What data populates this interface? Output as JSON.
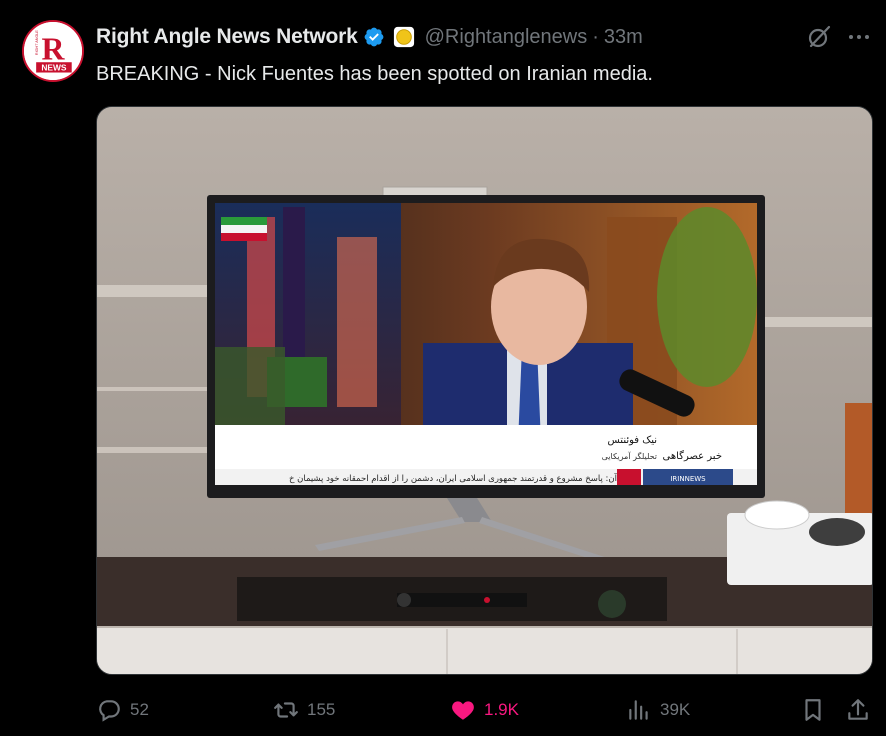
{
  "tweet": {
    "display_name": "Right Angle News Network",
    "handle": "@Rightanglenews",
    "separator": "·",
    "time": "33m",
    "text": "BREAKING - Nick Fuentes has been spotted on Iranian media.",
    "avatar": {
      "letter": "R",
      "brand_top": "RIGHT ANGLE",
      "brand_bottom": "NEWS"
    }
  },
  "media": {
    "tv_caption_name": "نیک فوئنتس",
    "tv_caption_title": "تحلیلگر آمریکایی",
    "tv_caption_channel": "خبر عصرگاهی",
    "tv_ticker": "آن: پاسخ مشروع و قدرتمند جمهوری اسلامی ایران، دشمن را از اقدام احمقانه خود پشیمان خ",
    "tv_logo": "IRINNEWS"
  },
  "actions": {
    "reply_count": "52",
    "repost_count": "155",
    "like_count": "1.9K",
    "views_count": "39K"
  },
  "colors": {
    "background": "#000000",
    "text": "#e7e9ea",
    "muted": "#71767b",
    "verified": "#1d9bf0",
    "like": "#f91880",
    "brand_red": "#c8102e"
  },
  "icons": [
    "verified-badge-icon",
    "affiliate-badge-icon",
    "grok-icon",
    "more-icon",
    "reply-icon",
    "repost-icon",
    "like-icon",
    "views-icon",
    "bookmark-icon",
    "share-icon"
  ]
}
